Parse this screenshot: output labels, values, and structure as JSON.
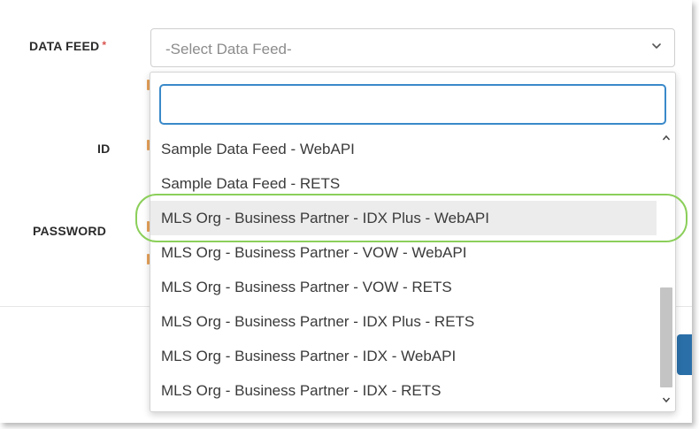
{
  "form": {
    "data_feed_label": "DATA FEED",
    "required_marker": "*",
    "id_label": "ID",
    "password_label": "PASSWORD",
    "select_placeholder": "-Select Data Feed-"
  },
  "dropdown": {
    "search_value": "",
    "options": [
      "Sample Data Feed - WebAPI",
      "Sample Data Feed - RETS",
      "MLS Org - Business Partner - IDX Plus - WebAPI",
      "MLS Org - Business Partner - VOW - WebAPI",
      "MLS Org - Business Partner - VOW - RETS",
      "MLS Org - Business Partner - IDX Plus - RETS",
      "MLS Org - Business Partner - IDX - WebAPI",
      "MLS Org - Business Partner - IDX - RETS"
    ],
    "highlighted_index": 2
  },
  "colors": {
    "accent": "#3a89c9",
    "required": "#d9534f",
    "highlight_ring": "#8bcf5a",
    "button": "#2a6fa8"
  }
}
